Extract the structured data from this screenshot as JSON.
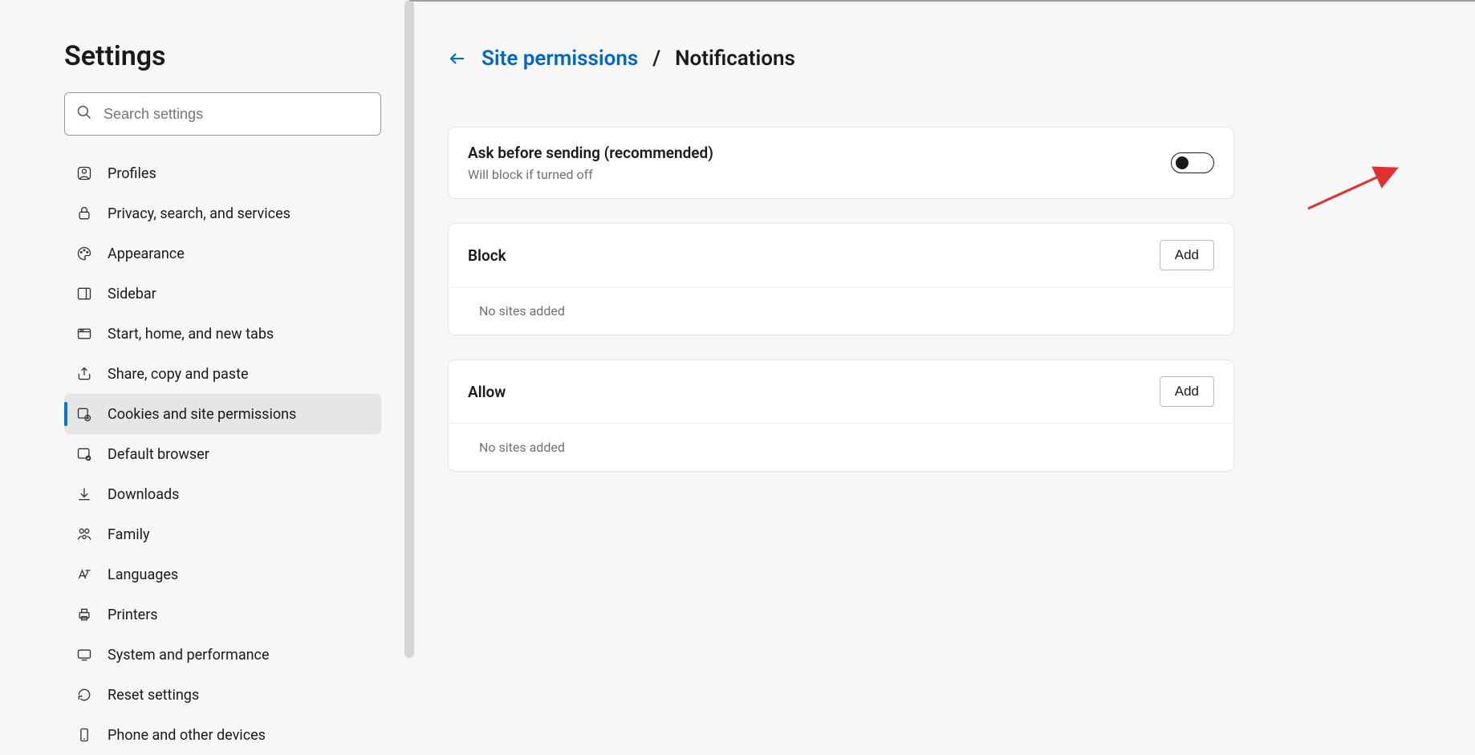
{
  "app": {
    "title": "Settings"
  },
  "search": {
    "placeholder": "Search settings"
  },
  "sidebar": {
    "items": [
      {
        "label": "Profiles",
        "active": false
      },
      {
        "label": "Privacy, search, and services",
        "active": false
      },
      {
        "label": "Appearance",
        "active": false
      },
      {
        "label": "Sidebar",
        "active": false
      },
      {
        "label": "Start, home, and new tabs",
        "active": false
      },
      {
        "label": "Share, copy and paste",
        "active": false
      },
      {
        "label": "Cookies and site permissions",
        "active": true
      },
      {
        "label": "Default browser",
        "active": false
      },
      {
        "label": "Downloads",
        "active": false
      },
      {
        "label": "Family",
        "active": false
      },
      {
        "label": "Languages",
        "active": false
      },
      {
        "label": "Printers",
        "active": false
      },
      {
        "label": "System and performance",
        "active": false
      },
      {
        "label": "Reset settings",
        "active": false
      },
      {
        "label": "Phone and other devices",
        "active": false
      }
    ]
  },
  "breadcrumb": {
    "parent": "Site permissions",
    "separator": "/",
    "current": "Notifications"
  },
  "askCard": {
    "title": "Ask before sending (recommended)",
    "subtitle": "Will block if turned off",
    "toggle_on": false
  },
  "blockCard": {
    "title": "Block",
    "button": "Add",
    "empty": "No sites added"
  },
  "allowCard": {
    "title": "Allow",
    "button": "Add",
    "empty": "No sites added"
  }
}
